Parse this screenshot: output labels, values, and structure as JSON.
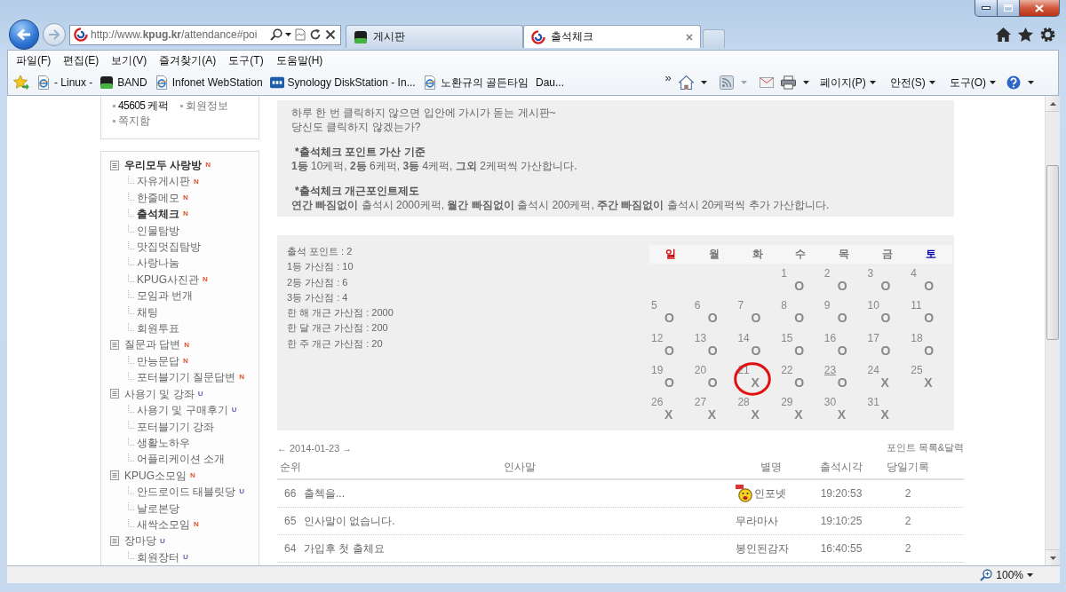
{
  "browser": {
    "url": "http://www.**kpug.kr**/attendance#poi",
    "tabs": [
      {
        "label": "게시판",
        "kind": "tile",
        "selected": false
      },
      {
        "label": "출석체크",
        "kind": "site",
        "selected": true
      }
    ],
    "menu": [
      "파일(F)",
      "편집(E)",
      "보기(V)",
      "즐겨찾기(A)",
      "도구(T)",
      "도움말(H)"
    ],
    "favorites": [
      {
        "label": "- Linux -",
        "kind": "page"
      },
      {
        "label": "BAND",
        "kind": "tile"
      },
      {
        "label": "Infonet WebStation",
        "kind": "page"
      },
      {
        "label": "Synology DiskStation - In...",
        "kind": "nas"
      },
      {
        "label": "노환규의 골든타임",
        "kind": "page"
      },
      {
        "label": "Dau...",
        "kind": "plain"
      }
    ],
    "favorites_more": "»",
    "commands": [
      "페이지(P)",
      "안전(S)",
      "도구(O)"
    ]
  },
  "user_box": {
    "items": [
      {
        "label": "45605 케퍽",
        "strong": true
      },
      {
        "label": "회원정보",
        "strong": false
      },
      {
        "label": "쪽지함",
        "strong": false
      }
    ]
  },
  "sidebar": {
    "items": [
      {
        "label": "우리모두 사랑방",
        "selected": true,
        "badge": {
          "text": "N",
          "kind": "new"
        },
        "children": [
          {
            "label": "자유게시판",
            "selected": false,
            "badge": {
              "text": "N",
              "kind": "new"
            }
          },
          {
            "label": "한줄메모",
            "selected": false,
            "badge": {
              "text": "N",
              "kind": "new"
            }
          },
          {
            "label": "출석체크",
            "selected": true,
            "badge": {
              "text": "N",
              "kind": "new"
            }
          },
          {
            "label": "인물탐방",
            "selected": false
          },
          {
            "label": "맛집멋집탐방",
            "selected": false
          },
          {
            "label": "사랑나눔",
            "selected": false
          },
          {
            "label": "KPUG사진관",
            "selected": false,
            "badge": {
              "text": "N",
              "kind": "new"
            }
          },
          {
            "label": "모임과 번개",
            "selected": false
          },
          {
            "label": "채팅",
            "selected": false
          },
          {
            "label": "회원투표",
            "selected": false
          }
        ]
      },
      {
        "label": "질문과 답변",
        "selected": false,
        "badge": {
          "text": "N",
          "kind": "new"
        },
        "children": [
          {
            "label": "만능문답",
            "selected": false,
            "badge": {
              "text": "N",
              "kind": "new"
            }
          },
          {
            "label": "포터블기기 질문답변",
            "selected": false,
            "badge": {
              "text": "N",
              "kind": "new"
            }
          }
        ]
      },
      {
        "label": "사용기 및 강좌",
        "selected": false,
        "badge": {
          "text": "U",
          "kind": "updated"
        },
        "children": [
          {
            "label": "사용기 및 구매후기",
            "selected": false,
            "badge": {
              "text": "U",
              "kind": "updated"
            }
          },
          {
            "label": "포터블기기 강좌",
            "selected": false
          },
          {
            "label": "생활노하우",
            "selected": false
          },
          {
            "label": "어플리케이션 소개",
            "selected": false
          }
        ]
      },
      {
        "label": "KPUG소모임",
        "selected": false,
        "badge": {
          "text": "N",
          "kind": "new"
        },
        "children": [
          {
            "label": "안드로이드 태블릿당",
            "selected": false,
            "badge": {
              "text": "U",
              "kind": "updated"
            }
          },
          {
            "label": "날로본당",
            "selected": false
          },
          {
            "label": "새싹소모임",
            "selected": false,
            "badge": {
              "text": "N",
              "kind": "new"
            }
          }
        ]
      },
      {
        "label": "장마당",
        "selected": false,
        "badge": {
          "text": "U",
          "kind": "updated"
        },
        "children": [
          {
            "label": "회원장터",
            "selected": false,
            "badge": {
              "text": "U",
              "kind": "updated"
            }
          }
        ]
      }
    ]
  },
  "notice": {
    "intro": [
      "하루 한 번 클릭하지 않으면 입안에 가시가 돋는 게시판~",
      "당신도 클릭하지 않겠는가?"
    ],
    "rules": [
      {
        "heading": "*출석체크 포인트 가산 기준",
        "text": "**1등** 10케퍽, **2등** 6케퍽, **3등** 4케퍽, **그외** 2케퍽씩 가산합니다."
      },
      {
        "heading": "*출석체크 개근포인트제도",
        "text": "**연간 빠짐없이** 출석시 2000케퍽, **월간 빠짐없이** 출석시 200케퍽, **주간 빠짐없이** 출석시 20케퍽씩 추가 가산합니다."
      }
    ]
  },
  "stats": [
    "출석 포인트 : 2",
    "1등 가산점 : 10",
    "2등 가산점 : 6",
    "3등 가산점 : 4",
    "한 해 개근 가산점 : 2000",
    "한 달 개근 가산점 : 200",
    "한 주 개근 가산점 : 20"
  ],
  "calendar": {
    "weekdays": [
      {
        "label": "일",
        "kind": "sunday"
      },
      {
        "label": "월",
        "kind": "weekday"
      },
      {
        "label": "화",
        "kind": "weekday"
      },
      {
        "label": "수",
        "kind": "weekday"
      },
      {
        "label": "목",
        "kind": "weekday"
      },
      {
        "label": "금",
        "kind": "weekday"
      },
      {
        "label": "토",
        "kind": "saturday"
      }
    ],
    "weeks": [
      [
        {
          "kind": "blank"
        },
        {
          "kind": "blank"
        },
        {
          "kind": "blank"
        },
        {
          "kind": "day",
          "day": "1",
          "mark": "O",
          "today": false,
          "circled": false
        },
        {
          "kind": "day",
          "day": "2",
          "mark": "O",
          "today": false,
          "circled": false
        },
        {
          "kind": "day",
          "day": "3",
          "mark": "O",
          "today": false,
          "circled": false
        },
        {
          "kind": "day",
          "day": "4",
          "mark": "O",
          "today": false,
          "circled": false
        }
      ],
      [
        {
          "kind": "day",
          "day": "5",
          "mark": "O",
          "today": false,
          "circled": false
        },
        {
          "kind": "day",
          "day": "6",
          "mark": "O",
          "today": false,
          "circled": false
        },
        {
          "kind": "day",
          "day": "7",
          "mark": "O",
          "today": false,
          "circled": false
        },
        {
          "kind": "day",
          "day": "8",
          "mark": "O",
          "today": false,
          "circled": false
        },
        {
          "kind": "day",
          "day": "9",
          "mark": "O",
          "today": false,
          "circled": false
        },
        {
          "kind": "day",
          "day": "10",
          "mark": "O",
          "today": false,
          "circled": false
        },
        {
          "kind": "day",
          "day": "11",
          "mark": "O",
          "today": false,
          "circled": false
        }
      ],
      [
        {
          "kind": "day",
          "day": "12",
          "mark": "O",
          "today": false,
          "circled": false
        },
        {
          "kind": "day",
          "day": "13",
          "mark": "O",
          "today": false,
          "circled": false
        },
        {
          "kind": "day",
          "day": "14",
          "mark": "O",
          "today": false,
          "circled": false
        },
        {
          "kind": "day",
          "day": "15",
          "mark": "O",
          "today": false,
          "circled": false
        },
        {
          "kind": "day",
          "day": "16",
          "mark": "O",
          "today": false,
          "circled": false
        },
        {
          "kind": "day",
          "day": "17",
          "mark": "O",
          "today": false,
          "circled": false
        },
        {
          "kind": "day",
          "day": "18",
          "mark": "O",
          "today": false,
          "circled": false
        }
      ],
      [
        {
          "kind": "day",
          "day": "19",
          "mark": "O",
          "today": false,
          "circled": false
        },
        {
          "kind": "day",
          "day": "20",
          "mark": "O",
          "today": false,
          "circled": false
        },
        {
          "kind": "day",
          "day": "21",
          "mark": "X",
          "today": false,
          "circled": true
        },
        {
          "kind": "day",
          "day": "22",
          "mark": "O",
          "today": false,
          "circled": false
        },
        {
          "kind": "day",
          "day": "23",
          "mark": "O",
          "today": true,
          "circled": false
        },
        {
          "kind": "day",
          "day": "24",
          "mark": "X",
          "today": false,
          "circled": false
        },
        {
          "kind": "day",
          "day": "25",
          "mark": "X",
          "today": false,
          "circled": false
        }
      ],
      [
        {
          "kind": "day",
          "day": "26",
          "mark": "X",
          "today": false,
          "circled": false
        },
        {
          "kind": "day",
          "day": "27",
          "mark": "X",
          "today": false,
          "circled": false
        },
        {
          "kind": "day",
          "day": "28",
          "mark": "X",
          "today": false,
          "circled": false
        },
        {
          "kind": "day",
          "day": "29",
          "mark": "X",
          "today": false,
          "circled": false
        },
        {
          "kind": "day",
          "day": "30",
          "mark": "X",
          "today": false,
          "circled": false
        },
        {
          "kind": "day",
          "day": "31",
          "mark": "X",
          "today": false,
          "circled": false
        }
      ]
    ]
  },
  "date_nav": {
    "prev": "←",
    "date": "2014-01-23",
    "next": "→",
    "link": "포인트 목록&달력"
  },
  "table": {
    "columns": [
      "순위",
      "인사말",
      "별명",
      "출석시각",
      "당일기록"
    ],
    "rows": [
      {
        "rank": "66",
        "greeting": "출첵을...",
        "nickname": "인포넷",
        "member_icon": true,
        "time": "19:20:53",
        "count": "2"
      },
      {
        "rank": "65",
        "greeting": "인사말이 없습니다.",
        "nickname": "무라마사",
        "member_icon": false,
        "time": "19:10:25",
        "count": "2"
      },
      {
        "rank": "64",
        "greeting": "가입후 첫 출체요",
        "nickname": "봉인된감자",
        "member_icon": false,
        "time": "16:40:55",
        "count": "2"
      }
    ]
  },
  "status_bar": {
    "zoom": "100%"
  }
}
